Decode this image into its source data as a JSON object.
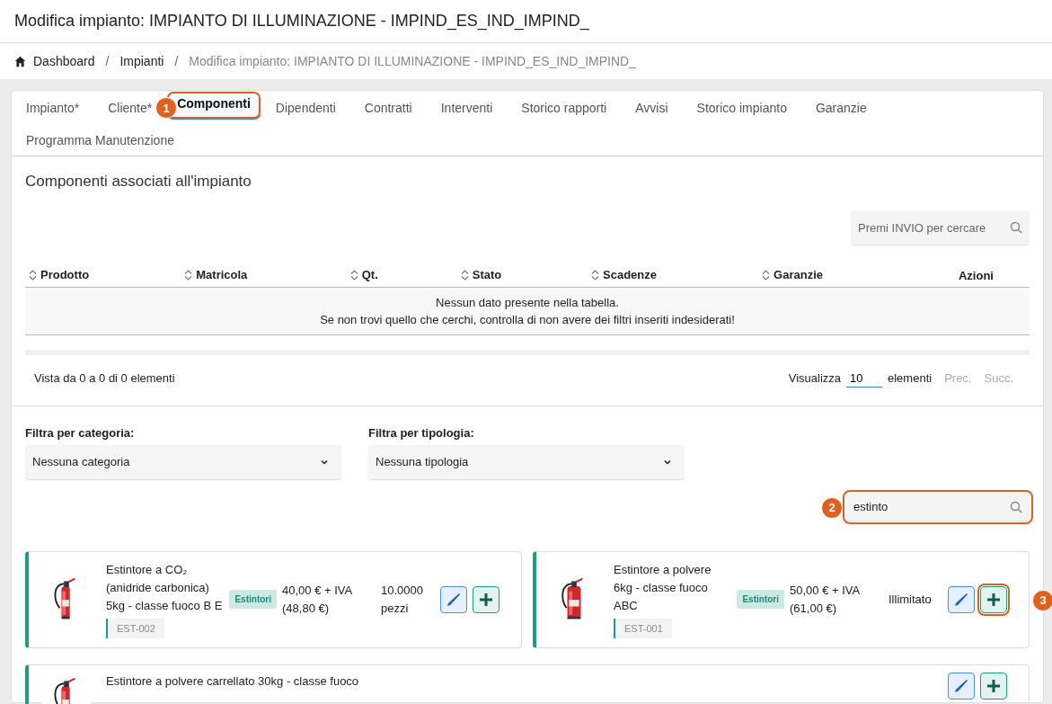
{
  "page_title": "Modifica impianto: IMPIANTO DI ILLUMINAZIONE - IMPIND_ES_IND_IMPIND_",
  "breadcrumb": [
    {
      "label": "Dashboard",
      "kind": "home"
    },
    {
      "label": "Impianti",
      "kind": "link",
      "separator": "/"
    },
    {
      "label": "Modifica impianto: IMPIANTO DI ILLUMINAZIONE - IMPIND_ES_IND_IMPIND_",
      "kind": "current",
      "separator": "/"
    }
  ],
  "tabs": [
    {
      "label": "Impianto*",
      "selected": false
    },
    {
      "label": "Cliente*",
      "selected": false
    },
    {
      "label": "Componenti",
      "selected": true,
      "callout": "1"
    },
    {
      "label": "Dipendenti",
      "selected": false
    },
    {
      "label": "Contratti",
      "selected": false
    },
    {
      "label": "Interventi",
      "selected": false
    },
    {
      "label": "Storico rapporti",
      "selected": false
    },
    {
      "label": "Avvisi",
      "selected": false
    },
    {
      "label": "Storico impianto",
      "selected": false
    },
    {
      "label": "Garanzie",
      "selected": false
    },
    {
      "label": "Programma Manutenzione",
      "selected": false
    }
  ],
  "section_title": "Componenti associati all'impianto",
  "table_search": {
    "placeholder": "Premi INVIO per cercare"
  },
  "table": {
    "columns": [
      {
        "label": "Prodotto",
        "sortable": true
      },
      {
        "label": "Matricola",
        "sortable": true
      },
      {
        "label": "Qt.",
        "sortable": true
      },
      {
        "label": "Stato",
        "sortable": true
      },
      {
        "label": "Scadenze",
        "sortable": true
      },
      {
        "label": "Garanzie",
        "sortable": true
      },
      {
        "label": "Azioni",
        "sortable": false
      }
    ],
    "empty_message": [
      "Nessun dato presente nella tabella.",
      "Se non trovi quello che cerchi, controlla di non avere dei filtri inseriti indesiderati!"
    ]
  },
  "pagination": {
    "info": "Vista da 0 a 0 di 0 elementi",
    "show_label": "Visualizza",
    "page_size": "10",
    "unit": "elementi",
    "prev": {
      "label": "Prec.",
      "disabled": true
    },
    "next": {
      "label": "Succ.",
      "disabled": true
    }
  },
  "filters": [
    {
      "label": "Filtra per categoria:",
      "value": "Nessuna categoria"
    },
    {
      "label": "Filtra per tipologia:",
      "value": "Nessuna tipologia"
    }
  ],
  "product_search": {
    "value": "estinto",
    "callout": "2"
  },
  "products": [
    {
      "name": "Estintore a CO₂ (anidride carbonica) 5kg - classe fuoco B E",
      "code": "EST-002",
      "category": "Estintori",
      "price": "40,00 € + IVA (48,80 €)",
      "stock": "10.0000 pezzi"
    },
    {
      "name": "Estintore a polvere 6kg - classe fuoco ABC",
      "code": "EST-001",
      "category": "Estintori",
      "price": "50,00 € + IVA (61,00 €)",
      "stock": "Illimitato",
      "add_callout": "3"
    },
    {
      "name": "Estintore a polvere carrellato 30kg - classe fuoco"
    }
  ]
}
